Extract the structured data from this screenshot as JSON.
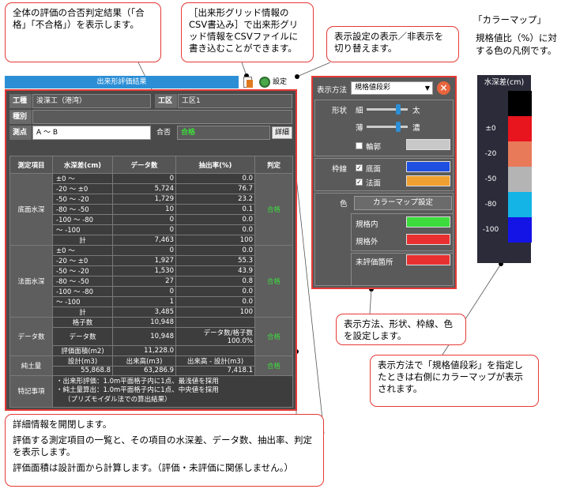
{
  "callouts": {
    "overall": "全体の評価の合否判定結果（「合格」「不合格」）を表示します。",
    "csv": "［出来形グリッド情報のCSV書込み］で出来形グリッド情報をCSVファイルに書き込むことができます。",
    "toggle": "表示設定の表示／非表示を切り替えます。",
    "settings": "表示方法、形状、枠線、色を設定します。",
    "colormap": "表示方法で「規格値段彩」を指定したときは右側にカラーマップが表示されます。",
    "detail_1": "詳細情報を開閉します。",
    "detail_2": "評価する測定項目の一覧と、その項目の水深差、データ数、抽出率、判定を表示します。",
    "detail_3": "評価面積は設計面から計算します。（評価・未評価に関係しません。）"
  },
  "window": {
    "title": "出来形評価結果",
    "settings_label": "設定"
  },
  "info": {
    "work_label": "工種",
    "work_value": "浚渫工（港湾）",
    "zone_label": "工区",
    "zone_value": "工区1",
    "type_label": "種別",
    "type_value": "",
    "point_label": "測点",
    "point_value": "A ～ B",
    "pass_label": "合否",
    "pass_value": "合格",
    "detail_button": "詳細"
  },
  "table": {
    "headers": [
      "測定項目",
      "水深差(cm)",
      "データ数",
      "抽出率(%)",
      "判定"
    ],
    "bottom": {
      "name": "底面水深",
      "judge": "合格",
      "rows": [
        [
          "±0 ～",
          "0",
          "0.0"
        ],
        [
          "-20 ～ ±0",
          "5,724",
          "76.7"
        ],
        [
          "-50 ～ -20",
          "1,729",
          "23.2"
        ],
        [
          "-80 ～ -50",
          "10",
          "0.1"
        ],
        [
          "-100 ～ -80",
          "0",
          "0.0"
        ],
        [
          "～ -100",
          "0",
          "0.0"
        ],
        [
          "計",
          "7,463",
          "100"
        ]
      ]
    },
    "slope": {
      "name": "法面水深",
      "judge": "合格",
      "rows": [
        [
          "±0 ～",
          "0",
          "0.0"
        ],
        [
          "-20 ～ ±0",
          "1,927",
          "55.3"
        ],
        [
          "-50 ～ -20",
          "1,530",
          "43.9"
        ],
        [
          "-80 ～ -50",
          "27",
          "0.8"
        ],
        [
          "-100 ～ -80",
          "0",
          "0.0"
        ],
        [
          "～ -100",
          "1",
          "0.0"
        ],
        [
          "計",
          "3,485",
          "100"
        ]
      ]
    },
    "count": {
      "name": "データ数",
      "judge": "合格",
      "grid_label": "格子数",
      "grid_value": "10,948",
      "data_label": "データ数",
      "data_value": "10,948",
      "ratio_text": "データ数/格子数 100.0%",
      "area_label": "評価面積(m2)",
      "area_value": "11,228.0"
    },
    "dredge": {
      "name": "純土量",
      "judge": "合格",
      "design_label": "設計(m3)",
      "design_value": "55,868.8",
      "built_label": "出来高(m3)",
      "built_value": "63,286.9",
      "diff_label": "出来高 - 設計(m3)",
      "diff_value": "7,418.1"
    },
    "notes": {
      "name": "特記事項",
      "line1": "・出来形評価：1.0m平面格子内に1点、最浅値を採用",
      "line2": "・純土量算出：1.0m平面格子内に1点、中央値を採用",
      "line3": "（プリズモイダル法での算出結果）"
    }
  },
  "settings": {
    "method_label": "表示方法",
    "method_value": "規格値段彩",
    "shape_label": "形状",
    "thin": "細",
    "thick": "太",
    "light": "薄",
    "dark": "濃",
    "shape_width_level": 0.8,
    "shape_density_level": 0.8,
    "outline_label": "輪郭",
    "frame_label": "枠線",
    "bottom_label": "底面",
    "slope_label": "法面",
    "color_label": "色",
    "colormap_button": "カラーマップ設定",
    "in_spec_label": "規格内",
    "out_spec_label": "規格外",
    "unevaluated_label": "未評価箇所",
    "colors": {
      "outline": "#c8c8c8",
      "bottom": "#1d4fe0",
      "slope": "#f0a030",
      "in_spec": "#3cdc3c",
      "out_spec": "#e83030",
      "unevaluated": "#e83030"
    }
  },
  "colormap": {
    "title": "「カラーマップ」",
    "description": "規格値比（%）に対する色の凡例です。",
    "header": "水深差(cm)",
    "bands": [
      {
        "label": "",
        "color": "#000000"
      },
      {
        "label": "±0",
        "color": "#e8141e"
      },
      {
        "label": "-20",
        "color": "#e87a5a"
      },
      {
        "label": "-50",
        "color": "#b4b4b4"
      },
      {
        "label": "-80",
        "color": "#14b4e6"
      },
      {
        "label": "-100",
        "color": "#1414e6"
      }
    ]
  }
}
